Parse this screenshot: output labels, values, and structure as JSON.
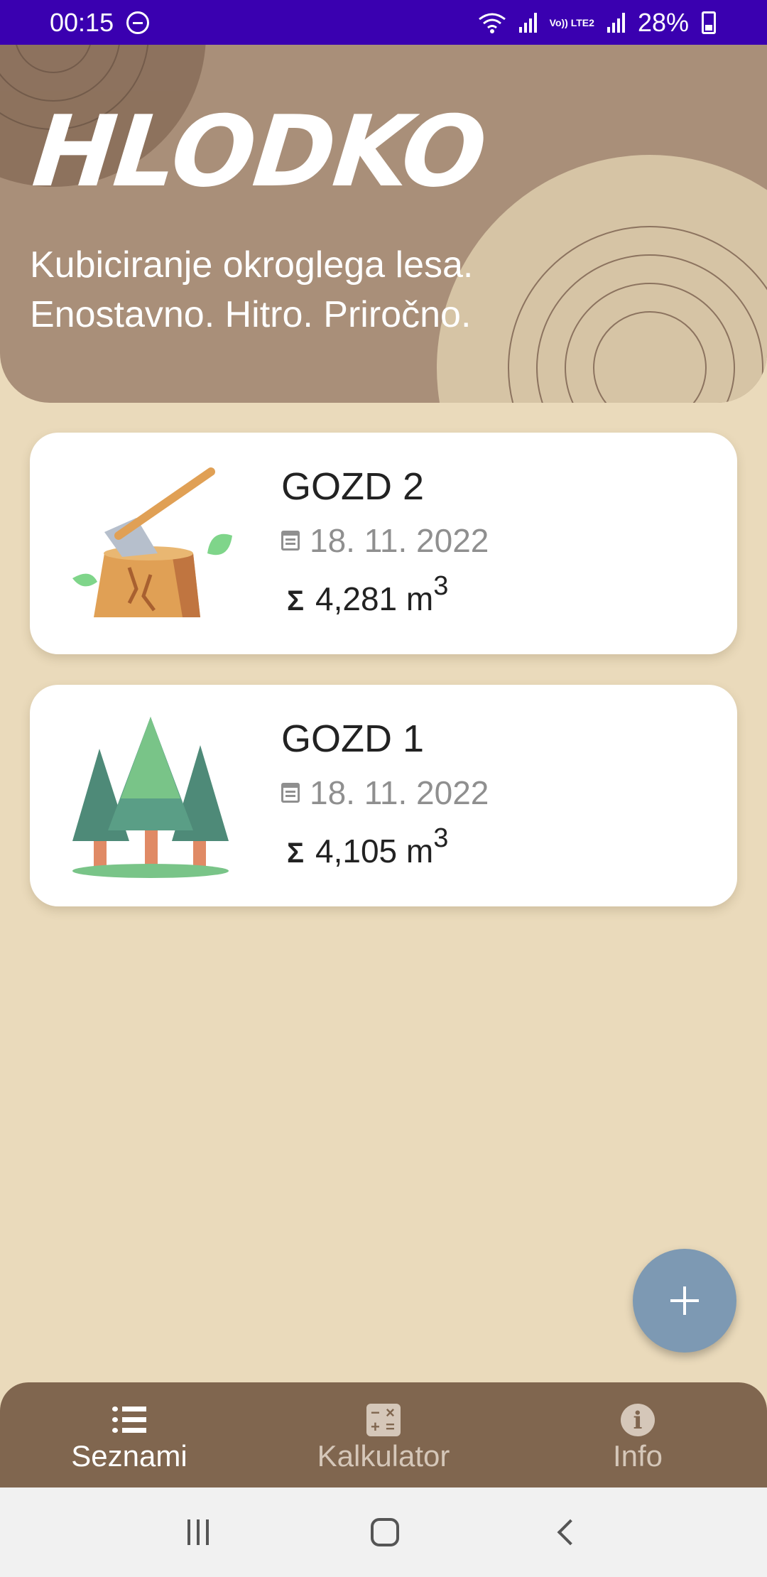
{
  "status_bar": {
    "time": "00:15",
    "battery": "28%",
    "network_label": "Vo)) LTE2"
  },
  "header": {
    "title": "HLODKO",
    "tagline_line1": "Kubiciranje okroglega lesa.",
    "tagline_line2": "Enostavno. Hitro. Priročno."
  },
  "lists": [
    {
      "name": "GOZD 2",
      "date": "18. 11. 2022",
      "volume": "4,281",
      "unit": "m",
      "unit_exp": "3",
      "icon": "axe-stump-icon"
    },
    {
      "name": "GOZD 1",
      "date": "18. 11. 2022",
      "volume": "4,105",
      "unit": "m",
      "unit_exp": "3",
      "icon": "forest-trees-icon"
    }
  ],
  "fab": {
    "icon": "plus-icon"
  },
  "bottom_nav": {
    "items": [
      {
        "label": "Seznami",
        "icon": "list-icon",
        "active": true
      },
      {
        "label": "Kalkulator",
        "icon": "calculator-icon",
        "active": false
      },
      {
        "label": "Info",
        "icon": "info-icon",
        "active": false
      }
    ]
  },
  "colors": {
    "status_bar": "#3a00b0",
    "header": "#a98f79",
    "background": "#eadabb",
    "fab": "#7d99b3",
    "bottom_nav": "#80664f"
  }
}
